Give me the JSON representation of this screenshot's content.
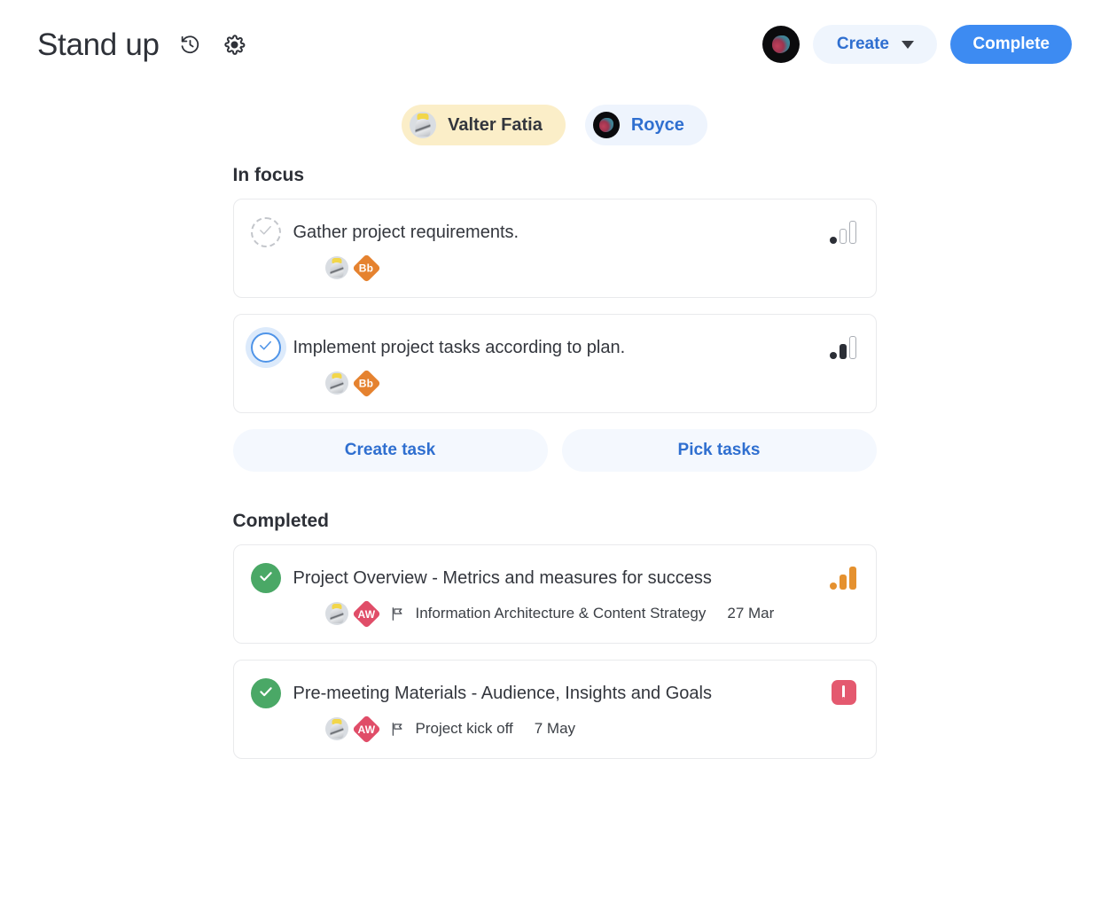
{
  "header": {
    "title": "Stand up",
    "history_icon": "history-icon",
    "settings_icon": "gear-icon",
    "avatar_name": "royce-avatar",
    "create_label": "Create",
    "create_caret_icon": "chevron-down-icon",
    "complete_label": "Complete",
    "accent_blue": "#3d8bf2",
    "soft_blue_bg": "#eff5fd"
  },
  "people": [
    {
      "name": "Valter Fatia",
      "state": "active",
      "avatar": "valter-avatar",
      "bg": "#fbeec8",
      "color": "#33363d"
    },
    {
      "name": "Royce",
      "state": "inactive",
      "avatar": "royce-avatar",
      "bg": "#eef4fd",
      "color": "#2f6fd0"
    }
  ],
  "sections": {
    "in_focus": {
      "heading": "In focus",
      "tasks": [
        {
          "title": "Gather project requirements.",
          "checkbox": "unchecked-dashed",
          "avatar": "valter-avatar",
          "badge": {
            "label": "Bb",
            "color": "#e5822f"
          },
          "priority": "low",
          "priority_icon": "priority-bars-low"
        },
        {
          "title": "Implement project tasks according to plan.",
          "checkbox": "unchecked-focused",
          "avatar": "valter-avatar",
          "badge": {
            "label": "Bb",
            "color": "#e5822f"
          },
          "priority": "medium",
          "priority_icon": "priority-bars-medium"
        }
      ],
      "actions": [
        {
          "label": "Create task"
        },
        {
          "label": "Pick tasks"
        }
      ]
    },
    "completed": {
      "heading": "Completed",
      "tasks": [
        {
          "title": "Project Overview - Metrics and measures for success",
          "checkbox": "checked",
          "avatar": "valter-avatar",
          "badge": {
            "label": "AW",
            "color": "#e04d68"
          },
          "flag_icon": "flag-icon",
          "milestone": "Information Architecture & Content Strategy",
          "date": "27 Mar",
          "priority": "high",
          "priority_icon": "priority-bars-high"
        },
        {
          "title": "Pre-meeting Materials - Audience, Insights and Goals",
          "checkbox": "checked",
          "avatar": "valter-avatar",
          "badge": {
            "label": "AW",
            "color": "#e04d68"
          },
          "flag_icon": "flag-icon",
          "milestone": "Project kick off",
          "date": "7 May",
          "priority": "urgent",
          "priority_icon": "alert-exclamation-badge"
        }
      ]
    }
  },
  "colors": {
    "green_done": "#4aa866",
    "orange_high": "#e5912f",
    "red_urgent": "#e4596f",
    "card_border": "#e9eaec"
  }
}
